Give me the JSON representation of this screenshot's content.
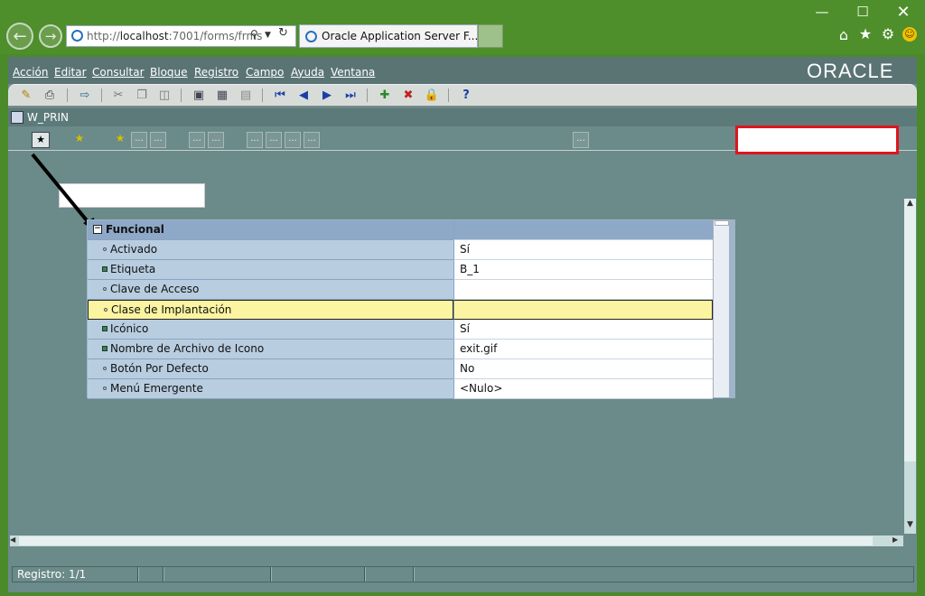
{
  "browser": {
    "url_prefix": "http://",
    "url_host": "localhost",
    "url_rest": ":7001/forms/frms",
    "tab_title": "Oracle Application Server F..."
  },
  "app": {
    "logo_text": "ORACLE",
    "menu": [
      "Acción",
      "Editar",
      "Consultar",
      "Bloque",
      "Registro",
      "Campo",
      "Ayuda",
      "Ventana"
    ],
    "window_title": "W_PRIN",
    "dots_label": "..."
  },
  "palette": {
    "group_label": "Funcional",
    "rows": [
      {
        "name": "Activado",
        "value": "Sí",
        "marker": "circle"
      },
      {
        "name": "Etiqueta",
        "value": "B_1",
        "marker": "square"
      },
      {
        "name": "Clave de Acceso",
        "value": "",
        "marker": "circle"
      },
      {
        "name": "Clase de Implantación",
        "value": "",
        "marker": "circle"
      },
      {
        "name": "Icónico",
        "value": "Sí",
        "marker": "square"
      },
      {
        "name": "Nombre de Archivo de Icono",
        "value": "exit.gif",
        "marker": "square"
      },
      {
        "name": "Botón Por Defecto",
        "value": "No",
        "marker": "circle"
      },
      {
        "name": "Menú Emergente",
        "value": "<Nulo>",
        "marker": "circle"
      }
    ]
  },
  "status": {
    "record_text": "Registro: 1/1"
  },
  "colors": {
    "highlight_row": "#fbf4a0",
    "annotation_box": "#e0141e",
    "chrome_green": "#4e8f2c"
  }
}
